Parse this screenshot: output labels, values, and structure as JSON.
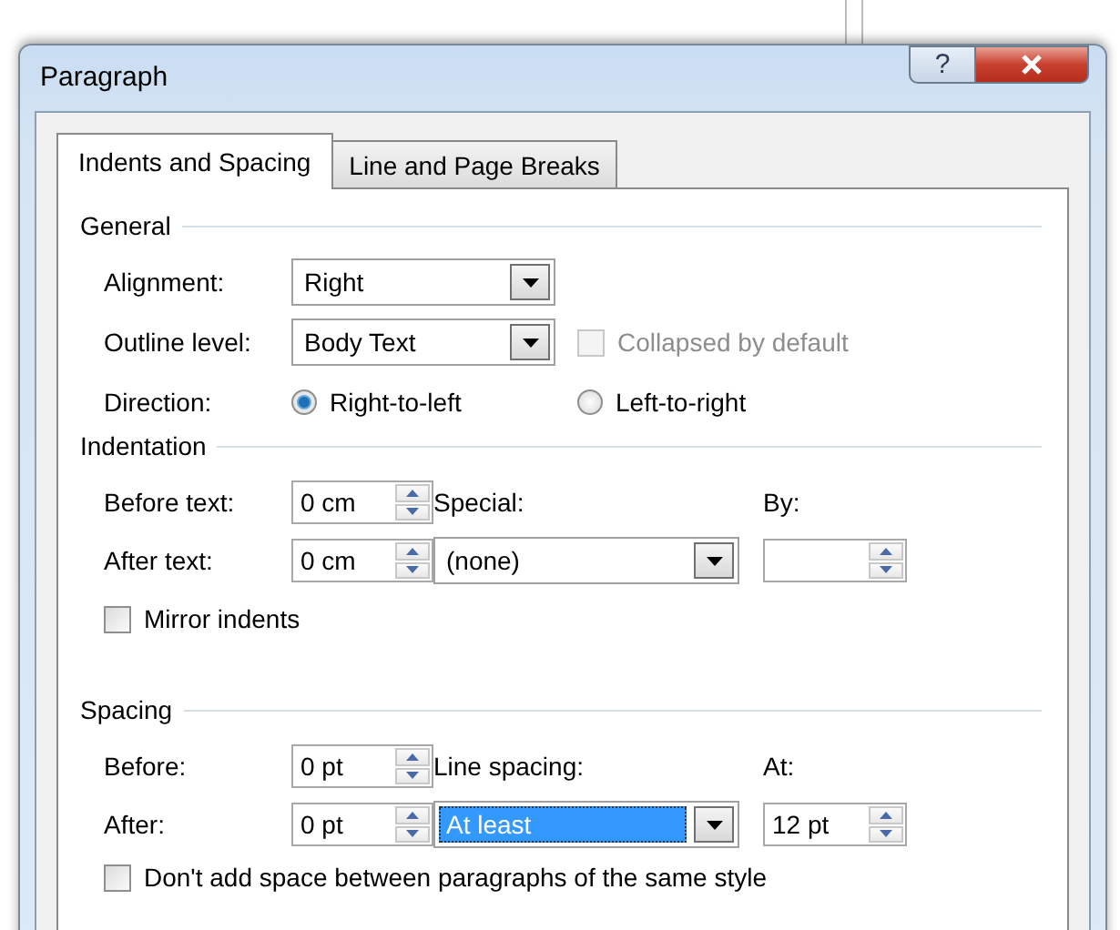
{
  "window": {
    "title": "Paragraph",
    "help_button": "?"
  },
  "tabs": [
    {
      "label": "Indents and Spacing",
      "selected": true
    },
    {
      "label": "Line and Page Breaks",
      "selected": false
    }
  ],
  "general": {
    "heading": "General",
    "alignment": {
      "label": "Alignment:",
      "value": "Right"
    },
    "outline_level": {
      "label": "Outline level:",
      "value": "Body Text"
    },
    "collapsed": {
      "label": "Collapsed by default",
      "checked": false,
      "disabled": true
    },
    "direction": {
      "label": "Direction:",
      "options": [
        {
          "label": "Right-to-left",
          "selected": true
        },
        {
          "label": "Left-to-right",
          "selected": false
        }
      ]
    }
  },
  "indentation": {
    "heading": "Indentation",
    "before_text": {
      "label": "Before text:",
      "value": "0 cm"
    },
    "after_text": {
      "label": "After text:",
      "value": "0 cm"
    },
    "special": {
      "label": "Special:",
      "value": "(none)"
    },
    "by": {
      "label": "By:"
    },
    "mirror": {
      "label": "Mirror indents",
      "checked": false
    }
  },
  "spacing": {
    "heading": "Spacing",
    "before": {
      "label": "Before:",
      "value": "0 pt"
    },
    "after": {
      "label": "After:",
      "value": "0 pt"
    },
    "line_spacing": {
      "label": "Line spacing:",
      "value": "At least",
      "focused": true
    },
    "at": {
      "label": "At:",
      "value": "12 pt"
    },
    "dont_add": {
      "label": "Don't add space between paragraphs of the same style",
      "checked": false
    }
  }
}
